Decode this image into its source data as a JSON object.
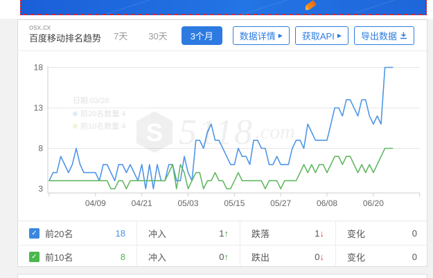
{
  "banner": {
    "bg_color_left": "#1b5fd8",
    "bg_color_right": "#2374e4",
    "border_color": "#f01616",
    "decoration": "rocket-icon"
  },
  "header": {
    "domain": "osx.cx",
    "title": "百度移动排名趋势",
    "tabs": [
      {
        "label": "7天",
        "active": false
      },
      {
        "label": "30天",
        "active": false
      },
      {
        "label": "3个月",
        "active": true
      }
    ],
    "buttons": [
      {
        "label": "数据详情",
        "icon": "caret-right",
        "caret": "▶"
      },
      {
        "label": "获取API",
        "icon": "caret-right",
        "caret": "▶"
      },
      {
        "label": "导出数据",
        "icon": "download"
      }
    ]
  },
  "ghost_tooltip": {
    "date_line": "日期:03/28",
    "rows": [
      {
        "label": "前20名数量",
        "value": "4",
        "color": "#4e95e6"
      },
      {
        "label": "前10名数量",
        "value": "4",
        "color": "#c8b83a"
      }
    ]
  },
  "watermark": {
    "logo_letter": "S",
    "text": "5118",
    "suffix": ".com"
  },
  "chart_data": {
    "type": "line",
    "title": "百度移动排名趋势 (osx.cx)",
    "x_start_date": "03/28",
    "x_end_date": "06/25",
    "x_tick_labels": [
      "04/09",
      "04/21",
      "05/03",
      "05/15",
      "05/27",
      "06/08",
      "06/20"
    ],
    "x_tick_day_indices": [
      12,
      24,
      36,
      48,
      60,
      72,
      84
    ],
    "x_axis_total_days": 96,
    "y_ticks": [
      3,
      8,
      13,
      18
    ],
    "ylim": [
      3,
      18
    ],
    "grid": true,
    "legend_position": "none",
    "series": [
      {
        "name": "前20名",
        "color": "#4e95e6",
        "values": [
          4,
          5,
          5,
          7,
          6,
          5,
          6,
          8,
          6,
          5,
          5,
          5,
          5,
          4,
          6,
          6,
          5,
          4,
          6,
          6,
          5,
          6,
          5,
          4,
          6,
          3,
          6,
          3,
          6,
          4,
          4,
          6,
          6,
          4,
          4,
          7,
          5,
          4,
          9,
          9,
          8,
          10,
          11,
          9,
          9,
          8,
          7,
          6,
          6,
          8,
          7,
          7,
          6,
          9,
          9,
          8,
          8,
          6,
          6,
          7,
          6,
          6,
          6,
          8,
          9,
          9,
          8,
          11,
          10,
          9,
          9,
          9,
          9,
          11,
          13,
          13,
          12,
          14,
          14,
          13,
          12,
          14,
          14,
          12,
          11,
          12,
          11,
          18,
          18,
          18
        ]
      },
      {
        "name": "前10名",
        "color": "#62b862",
        "values": [
          4,
          4,
          4,
          4,
          4,
          4,
          4,
          4,
          4,
          4,
          4,
          4,
          4,
          4,
          4,
          4,
          3,
          3,
          4,
          4,
          3,
          4,
          4,
          4,
          4,
          4,
          4,
          4,
          4,
          4,
          4,
          5,
          6,
          3,
          6,
          5,
          3,
          4,
          5,
          5,
          3,
          4,
          4,
          5,
          4,
          4,
          3,
          3,
          4,
          5,
          4,
          4,
          4,
          4,
          4,
          4,
          3,
          4,
          4,
          4,
          3,
          4,
          4,
          4,
          4,
          5,
          6,
          5,
          6,
          5,
          6,
          6,
          5,
          6,
          7,
          7,
          6,
          7,
          7,
          6,
          5,
          6,
          5,
          6,
          5,
          6,
          7,
          8,
          8,
          8
        ]
      }
    ]
  },
  "table": {
    "rows": [
      {
        "check": "✓",
        "checkbox_color": "#3a87e0",
        "name": "前20名",
        "value": "18",
        "value_color": "#4a90e2",
        "col2_label": "冲入",
        "col2_value": "1",
        "col2_arrow": "↑",
        "col3_label": "跌落",
        "col3_value": "1",
        "col3_arrow": "↓",
        "col4_label": "变化",
        "col4_value": "0"
      },
      {
        "check": "✓",
        "checkbox_color": "#49b84c",
        "name": "前10名",
        "value": "8",
        "value_color": "#52b052",
        "col2_label": "冲入",
        "col2_value": "0",
        "col2_arrow": "↑",
        "col3_label": "跌出",
        "col3_value": "0",
        "col3_arrow": "↓",
        "col4_label": "变化",
        "col4_value": "0"
      }
    ]
  }
}
